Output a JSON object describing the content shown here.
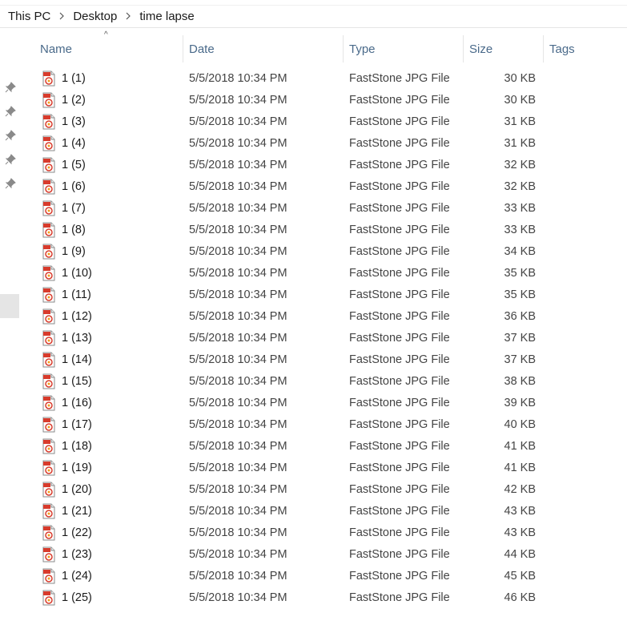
{
  "breadcrumb": {
    "items": [
      "This PC",
      "Desktop",
      "time lapse"
    ]
  },
  "columns": {
    "name": "Name",
    "date": "Date",
    "type": "Type",
    "size": "Size",
    "tags": "Tags"
  },
  "sort_indicator": "^",
  "icons": {
    "file": "faststone-jpg-file-icon",
    "pin": "pin-icon",
    "separator": "chevron-right-icon"
  },
  "files": [
    {
      "name": "1 (1)",
      "date": "5/5/2018 10:34 PM",
      "type": "FastStone JPG File",
      "size": "30 KB"
    },
    {
      "name": "1 (2)",
      "date": "5/5/2018 10:34 PM",
      "type": "FastStone JPG File",
      "size": "30 KB"
    },
    {
      "name": "1 (3)",
      "date": "5/5/2018 10:34 PM",
      "type": "FastStone JPG File",
      "size": "31 KB"
    },
    {
      "name": "1 (4)",
      "date": "5/5/2018 10:34 PM",
      "type": "FastStone JPG File",
      "size": "31 KB"
    },
    {
      "name": "1 (5)",
      "date": "5/5/2018 10:34 PM",
      "type": "FastStone JPG File",
      "size": "32 KB"
    },
    {
      "name": "1 (6)",
      "date": "5/5/2018 10:34 PM",
      "type": "FastStone JPG File",
      "size": "32 KB"
    },
    {
      "name": "1 (7)",
      "date": "5/5/2018 10:34 PM",
      "type": "FastStone JPG File",
      "size": "33 KB"
    },
    {
      "name": "1 (8)",
      "date": "5/5/2018 10:34 PM",
      "type": "FastStone JPG File",
      "size": "33 KB"
    },
    {
      "name": "1 (9)",
      "date": "5/5/2018 10:34 PM",
      "type": "FastStone JPG File",
      "size": "34 KB"
    },
    {
      "name": "1 (10)",
      "date": "5/5/2018 10:34 PM",
      "type": "FastStone JPG File",
      "size": "35 KB"
    },
    {
      "name": "1 (11)",
      "date": "5/5/2018 10:34 PM",
      "type": "FastStone JPG File",
      "size": "35 KB"
    },
    {
      "name": "1 (12)",
      "date": "5/5/2018 10:34 PM",
      "type": "FastStone JPG File",
      "size": "36 KB"
    },
    {
      "name": "1 (13)",
      "date": "5/5/2018 10:34 PM",
      "type": "FastStone JPG File",
      "size": "37 KB"
    },
    {
      "name": "1 (14)",
      "date": "5/5/2018 10:34 PM",
      "type": "FastStone JPG File",
      "size": "37 KB"
    },
    {
      "name": "1 (15)",
      "date": "5/5/2018 10:34 PM",
      "type": "FastStone JPG File",
      "size": "38 KB"
    },
    {
      "name": "1 (16)",
      "date": "5/5/2018 10:34 PM",
      "type": "FastStone JPG File",
      "size": "39 KB"
    },
    {
      "name": "1 (17)",
      "date": "5/5/2018 10:34 PM",
      "type": "FastStone JPG File",
      "size": "40 KB"
    },
    {
      "name": "1 (18)",
      "date": "5/5/2018 10:34 PM",
      "type": "FastStone JPG File",
      "size": "41 KB"
    },
    {
      "name": "1 (19)",
      "date": "5/5/2018 10:34 PM",
      "type": "FastStone JPG File",
      "size": "41 KB"
    },
    {
      "name": "1 (20)",
      "date": "5/5/2018 10:34 PM",
      "type": "FastStone JPG File",
      "size": "42 KB"
    },
    {
      "name": "1 (21)",
      "date": "5/5/2018 10:34 PM",
      "type": "FastStone JPG File",
      "size": "43 KB"
    },
    {
      "name": "1 (22)",
      "date": "5/5/2018 10:34 PM",
      "type": "FastStone JPG File",
      "size": "43 KB"
    },
    {
      "name": "1 (23)",
      "date": "5/5/2018 10:34 PM",
      "type": "FastStone JPG File",
      "size": "44 KB"
    },
    {
      "name": "1 (24)",
      "date": "5/5/2018 10:34 PM",
      "type": "FastStone JPG File",
      "size": "45 KB"
    },
    {
      "name": "1 (25)",
      "date": "5/5/2018 10:34 PM",
      "type": "FastStone JPG File",
      "size": "46 KB"
    }
  ]
}
